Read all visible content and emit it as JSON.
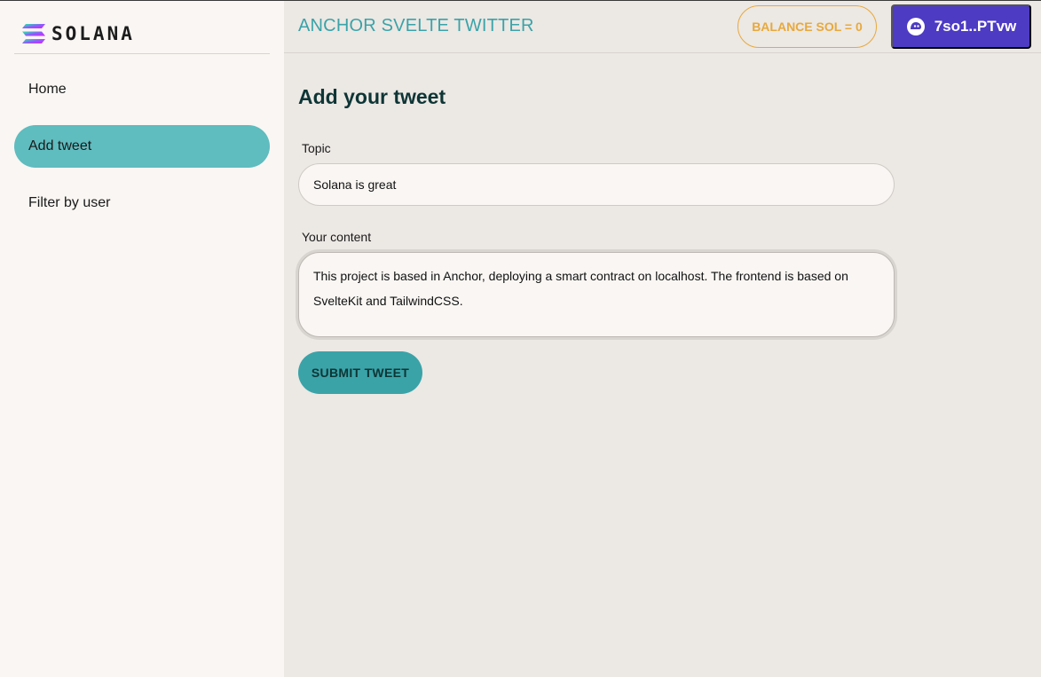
{
  "brand": {
    "logo_text": "SOLANA",
    "logo_icon": "solana-logo-icon",
    "gradient_colors": [
      "#9945ff",
      "#19fb9b"
    ]
  },
  "sidebar": {
    "items": [
      {
        "label": "Home",
        "active": false
      },
      {
        "label": "Add tweet",
        "active": true
      },
      {
        "label": "Filter by user",
        "active": false
      }
    ]
  },
  "header": {
    "title": "ANCHOR SVELTE TWITTER",
    "balance_label": "BALANCE SOL = 0",
    "wallet_label": "7so1..PTvw",
    "wallet_icon": "phantom-ghost-icon"
  },
  "form": {
    "heading": "Add your tweet",
    "topic_label": "Topic",
    "topic_value": "Solana is great",
    "content_label": "Your content",
    "content_value": "This project is based in Anchor, deploying a smart contract on localhost. The frontend is based on SvelteKit and TailwindCSS.",
    "submit_label": "SUBMIT TWEET"
  },
  "colors": {
    "accent": "#3aa3a8",
    "active_nav": "#5fbcbf",
    "balance": "#e7a93c",
    "wallet": "#4d3bc4",
    "heading": "#0e3535"
  }
}
